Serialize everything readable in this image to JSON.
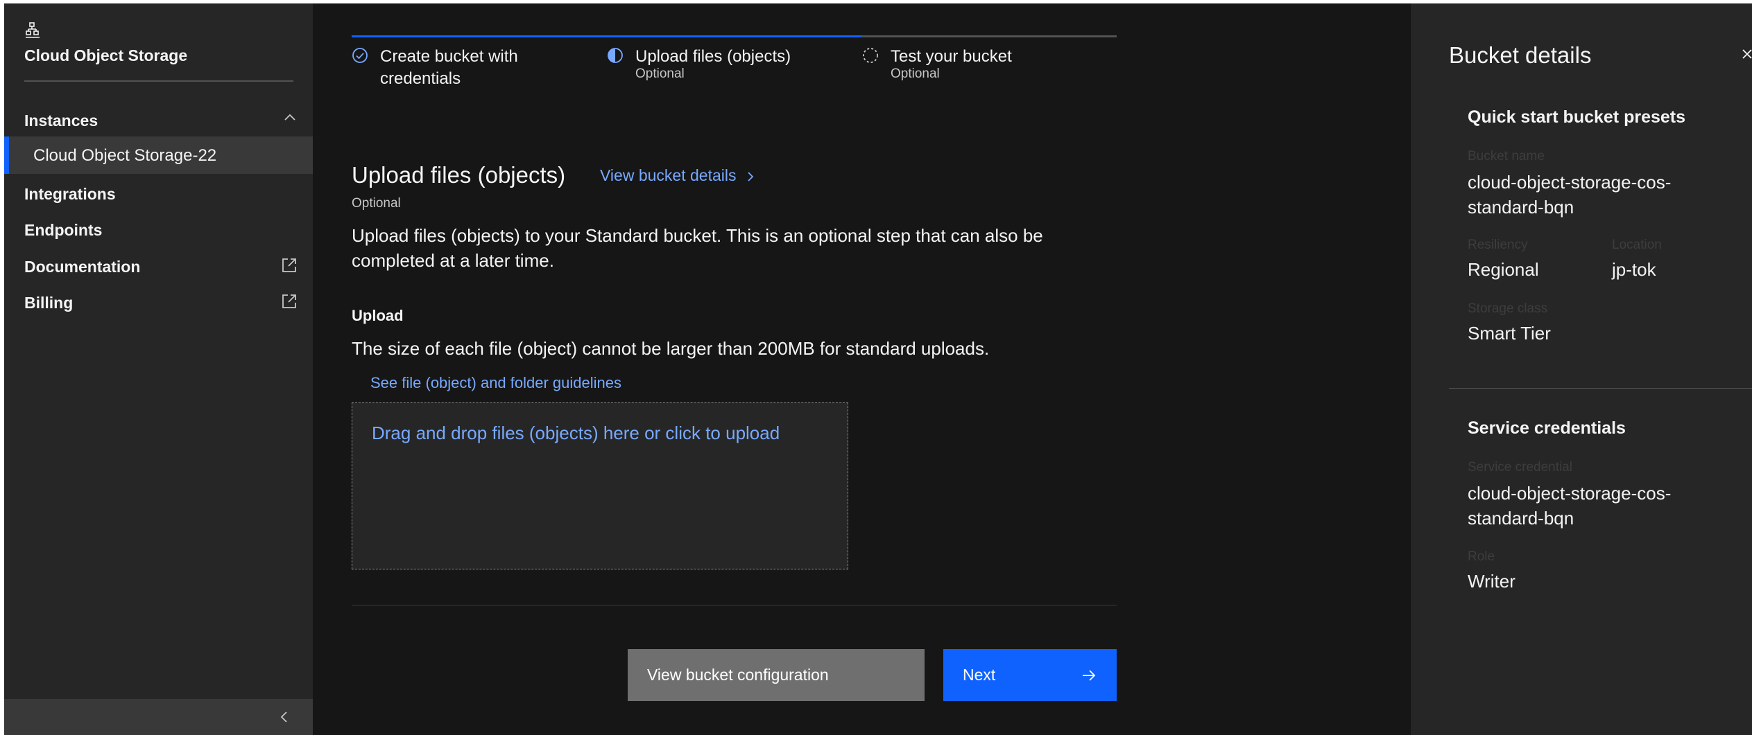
{
  "sidebar": {
    "title": "Cloud Object Storage",
    "nav": {
      "instances": "Instances",
      "instance_item": "Cloud Object Storage-22",
      "integrations": "Integrations",
      "endpoints": "Endpoints",
      "documentation": "Documentation",
      "billing": "Billing"
    }
  },
  "progress": {
    "steps": [
      {
        "label": "Create bucket with credentials",
        "sublabel": "",
        "state": "complete"
      },
      {
        "label": "Upload files (objects)",
        "sublabel": "Optional",
        "state": "current"
      },
      {
        "label": "Test your bucket",
        "sublabel": "Optional",
        "state": "incomplete"
      }
    ]
  },
  "main": {
    "title": "Upload files (objects)",
    "view_details_link": "View bucket details",
    "optional_tag": "Optional",
    "description": "Upload files (objects) to your Standard bucket. This is an optional step that can also be completed at a later time.",
    "upload_heading": "Upload",
    "size_note": "The size of each file (object) cannot be larger than 200MB for standard uploads.",
    "guidelines_link": "See file (object) and folder guidelines",
    "dropzone_text": "Drag and drop files (objects) here or click to upload",
    "buttons": {
      "secondary": "View bucket configuration",
      "primary": "Next"
    }
  },
  "panel": {
    "title": "Bucket details",
    "presets_section": "Quick start bucket presets",
    "bucket_name_label": "Bucket name",
    "bucket_name_value": "cloud-object-storage-cos-standard-bqn",
    "resiliency_label": "Resiliency",
    "resiliency_value": "Regional",
    "location_label": "Location",
    "location_value": "jp-tok",
    "storage_class_label": "Storage class",
    "storage_class_value": "Smart Tier",
    "credentials_section": "Service credentials",
    "service_credential_label": "Service credential",
    "service_credential_value": "cloud-object-storage-cos-standard-bqn",
    "role_label": "Role",
    "role_value": "Writer"
  },
  "colors": {
    "background": "#161616",
    "sidebar": "#262626",
    "selected_item": "#393939",
    "accent_blue": "#0f62fe",
    "link_blue": "#78a9ff",
    "secondary_button": "#6f6f6f"
  },
  "icons": {
    "logo": "cloud-object-storage-icon",
    "expand": "chevron-up-icon",
    "external": "launch-icon",
    "collapse": "chevron-left-icon",
    "step_complete": "checkmark-outline-icon",
    "step_current": "half-circle-icon",
    "step_incomplete": "dashed-circle-icon",
    "link_chevron": "chevron-right-icon",
    "next": "arrow-right-icon",
    "close": "close-icon"
  }
}
